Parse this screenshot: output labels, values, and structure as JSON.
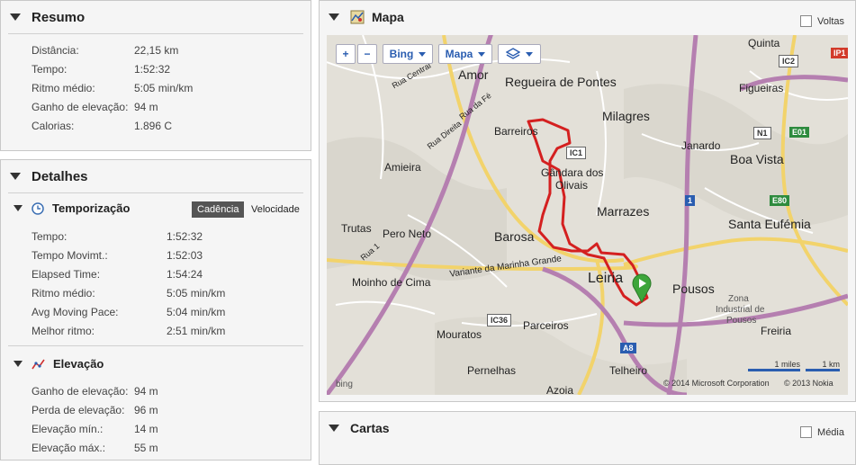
{
  "resumo": {
    "title": "Resumo",
    "rows": [
      {
        "label": "Distância:",
        "value": "22,15 km"
      },
      {
        "label": "Tempo:",
        "value": "1:52:32"
      },
      {
        "label": "Ritmo médio:",
        "value": "5:05 min/km"
      },
      {
        "label": "Ganho de elevação:",
        "value": "94 m"
      },
      {
        "label": "Calorias:",
        "value": "1.896 C"
      }
    ]
  },
  "detalhes": {
    "title": "Detalhes",
    "temporizacao": {
      "title": "Temporização",
      "tabs": [
        "Cadência",
        "Velocidade"
      ],
      "rows": [
        {
          "label": "Tempo:",
          "value": "1:52:32"
        },
        {
          "label": "Tempo Movimt.:",
          "value": "1:52:03"
        },
        {
          "label": "Elapsed Time:",
          "value": "1:54:24"
        },
        {
          "label": "Ritmo médio:",
          "value": "5:05 min/km"
        },
        {
          "label": "Avg Moving Pace:",
          "value": "5:04 min/km"
        },
        {
          "label": "Melhor ritmo:",
          "value": "2:51 min/km"
        }
      ]
    },
    "elevacao": {
      "title": "Elevação",
      "rows": [
        {
          "label": "Ganho de elevação:",
          "value": "94 m"
        },
        {
          "label": "Perda de elevação:",
          "value": "96 m"
        },
        {
          "label": "Elevação mín.:",
          "value": "14 m"
        },
        {
          "label": "Elevação máx.:",
          "value": "55 m"
        }
      ]
    }
  },
  "mapa": {
    "title": "Mapa",
    "voltas_label": "Voltas",
    "controls": {
      "zoom_in": "+",
      "zoom_out": "−",
      "provider": "Bing",
      "type": "Mapa"
    },
    "places": [
      "Quinta",
      "Amor",
      "Regueira de Pontes",
      "Figueiras",
      "Milagres",
      "Barreiros",
      "Amieira",
      "Gândara dos",
      "Olivais",
      "Janardo",
      "Boa Vista",
      "Marrazes",
      "Trutas",
      "Pero Neto",
      "Barosa",
      "Santa Eufémia",
      "Leiria",
      "Pousos",
      "Moinho de Cima",
      "Parceiros",
      "Zona",
      "Industrial de",
      "Pousos",
      "Mouratos",
      "Freiria",
      "Pernelhas",
      "Telheiro",
      "Azoia"
    ],
    "roads": [
      "Rua Central",
      "Rua da Fé",
      "Rua Direita",
      "Rua 1",
      "Variante da Marinha Grande"
    ],
    "shields": [
      "IC2",
      "IP1",
      "N1",
      "E01",
      "IC1",
      "1",
      "E80",
      "IC36",
      "A8"
    ],
    "scale": {
      "miles": "1 miles",
      "km": "1 km"
    },
    "brand": "bing",
    "copyright1": "© 2014 Microsoft Corporation",
    "copyright2": "© 2013 Nokia"
  },
  "cartas": {
    "title": "Cartas",
    "media_label": "Média"
  }
}
